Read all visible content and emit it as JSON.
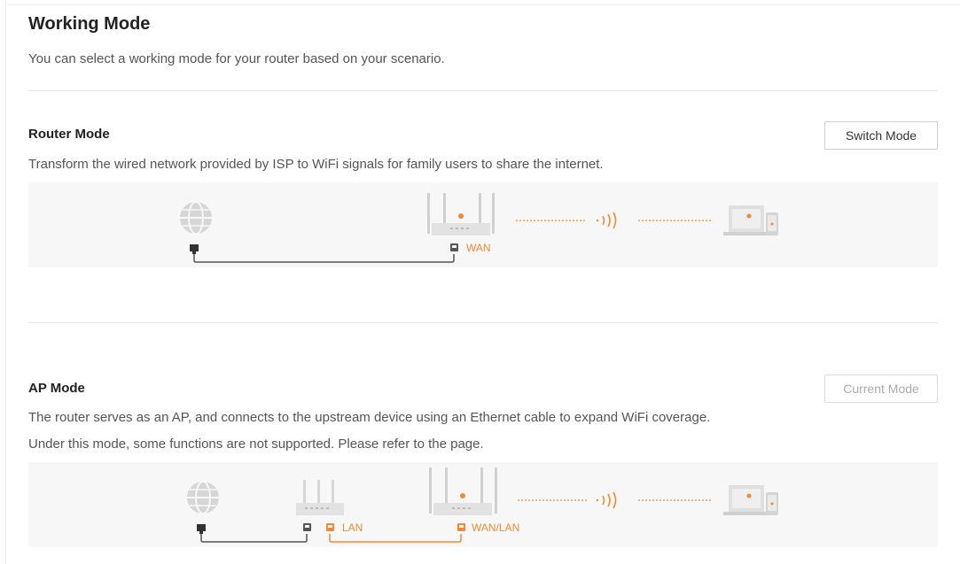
{
  "page": {
    "title": "Working Mode",
    "description": "You can select a working mode for your router based on your scenario."
  },
  "modes": [
    {
      "title": "Router Mode",
      "description": "Transform the wired network provided by ISP to WiFi signals for family users to share the internet.",
      "button_label": "Switch Mode",
      "button_enabled": true,
      "diagram": {
        "icons": [
          "globe-icon",
          "router-icon",
          "wifi-signal-icon",
          "laptop-icon",
          "phone-icon"
        ],
        "port_labels": [
          "WAN"
        ]
      }
    },
    {
      "title": "AP Mode",
      "description_lines": [
        "The router serves as an AP, and connects to the upstream device using an Ethernet cable to expand WiFi coverage.",
        "Under this mode, some functions are not supported. Please refer to the page."
      ],
      "button_label": "Current Mode",
      "button_enabled": false,
      "diagram": {
        "icons": [
          "globe-icon",
          "upstream-router-icon",
          "router-icon",
          "wifi-signal-icon",
          "laptop-icon",
          "phone-icon"
        ],
        "port_labels": [
          "LAN",
          "WAN/LAN"
        ]
      }
    }
  ],
  "colors": {
    "accent": "#f08a36",
    "cable": "#555555",
    "device": "#d0d0d0",
    "panel_bg": "#f7f7f7"
  }
}
